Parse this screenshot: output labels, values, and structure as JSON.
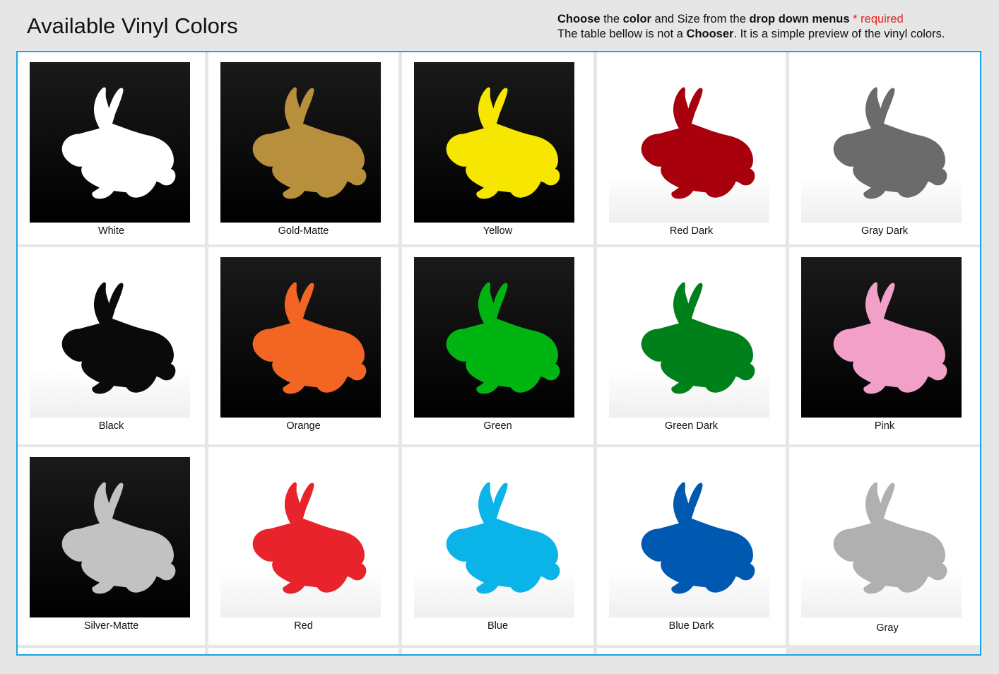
{
  "header": {
    "title": "Available Vinyl Colors"
  },
  "instructions": {
    "line1_bold_1": "Choose",
    "line1_text_1": " the ",
    "line1_bold_2": "color",
    "line1_text_2": " and Size from the ",
    "line1_bold_3": "drop down menus",
    "line1_required": " * required",
    "line2_text_1": "The table bellow is not a ",
    "line2_bold": "Chooser",
    "line2_text_2": ". It is a simple preview of the vinyl colors."
  },
  "colors": {
    "frame_border": "#1aa3e8",
    "required_text": "#e0261c",
    "page_background": "#e6e6e6"
  },
  "swatches": [
    {
      "label": "White",
      "fill": "#ffffff",
      "background": "dark",
      "icon": "rabbit-icon"
    },
    {
      "label": "Gold-Matte",
      "fill": "#b8903d",
      "background": "dark",
      "icon": "rabbit-icon"
    },
    {
      "label": "Yellow",
      "fill": "#f7e600",
      "background": "dark",
      "icon": "rabbit-icon"
    },
    {
      "label": "Red Dark",
      "fill": "#a8000c",
      "background": "light",
      "icon": "rabbit-icon"
    },
    {
      "label": "Gray Dark",
      "fill": "#6b6b6b",
      "background": "light",
      "icon": "rabbit-icon"
    },
    {
      "label": "Black",
      "fill": "#0a0a0a",
      "background": "light",
      "icon": "rabbit-icon"
    },
    {
      "label": "Orange",
      "fill": "#f26522",
      "background": "dark",
      "icon": "rabbit-icon"
    },
    {
      "label": "Green",
      "fill": "#00b512",
      "background": "dark",
      "icon": "rabbit-icon"
    },
    {
      "label": "Green Dark",
      "fill": "#00801a",
      "background": "light",
      "icon": "rabbit-icon"
    },
    {
      "label": "Pink",
      "fill": "#f2a0c8",
      "background": "dark",
      "icon": "rabbit-icon"
    },
    {
      "label": "Silver-Matte",
      "fill": "#c2c2c2",
      "background": "dark",
      "icon": "rabbit-icon"
    },
    {
      "label": "Red",
      "fill": "#e8232b",
      "background": "light",
      "icon": "rabbit-icon"
    },
    {
      "label": "Blue",
      "fill": "#0ab4e8",
      "background": "light",
      "icon": "rabbit-icon"
    },
    {
      "label": "Blue Dark",
      "fill": "#0059b0",
      "background": "light",
      "icon": "rabbit-icon"
    },
    {
      "label": "Gray",
      "fill": "#b0b0b0",
      "background": "light",
      "icon": "rabbit-icon"
    }
  ]
}
